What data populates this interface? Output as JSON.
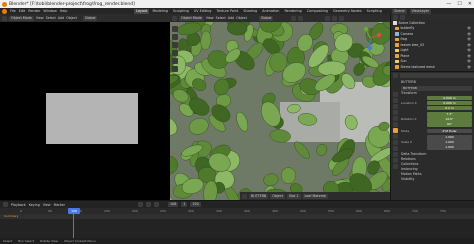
{
  "window": {
    "title": "Blender* [F:\\tobi\\blender-project\\frog\\frog_render.blend]",
    "controls": [
      "—",
      "☐",
      "✕"
    ]
  },
  "menu": {
    "items": [
      "File",
      "Edit",
      "Render",
      "Window",
      "Help"
    ],
    "workspaces": [
      "Layout",
      "Modeling",
      "Sculpting",
      "UV Editing",
      "Texture Paint",
      "Shading",
      "Animation",
      "Rendering",
      "Compositing",
      "Geometry Nodes",
      "Scripting"
    ],
    "active_workspace": "Layout",
    "scene_label": "Scene",
    "view_layer_label": "ViewLayer"
  },
  "left_editor": {
    "header_items": [
      "View",
      "Select",
      "Add",
      "Object"
    ],
    "mode": "Object Mode",
    "transform": "Global"
  },
  "viewport": {
    "mode": "Object Mode",
    "header_items": [
      "View",
      "Select",
      "Add",
      "Object"
    ],
    "transform": "Global",
    "leaf_color": "#5f8a3a",
    "bg_color": "#8a8f8a"
  },
  "outliner": {
    "title": "Scene Collection",
    "rows": [
      {
        "label": "butterfly",
        "color": "#e8a040"
      },
      {
        "label": "Camera",
        "color": "#8fb6d9"
      },
      {
        "label": "frog",
        "color": "#e8a040"
      },
      {
        "label": "leaves tree_03",
        "color": "#e8a040"
      },
      {
        "label": "Light",
        "color": "#e8d070"
      },
      {
        "label": "Plane",
        "color": "#e8a040"
      },
      {
        "label": "Sun",
        "color": "#e8d070"
      },
      {
        "label": "Stems textured mesh",
        "color": "#e8a040"
      }
    ]
  },
  "properties": {
    "object_name": "BUTTERB",
    "data_name": "BUTTERB",
    "section_transform": "Transform",
    "location_label": "Location X",
    "location": [
      "0.006 m",
      "0.006 m",
      "0.2 m"
    ],
    "rotation_label": "Rotation X",
    "rotation": [
      "7.3°",
      "16.6°",
      "90°"
    ],
    "mode_label": "Mode",
    "mode_value": "XYZ Euler",
    "scale_label": "Scale X",
    "scale": [
      "1.000",
      "1.000",
      "1.000"
    ],
    "collapsed_sections": [
      "Delta Transform",
      "Relations",
      "Collections",
      "Instancing",
      "Motion Paths",
      "Visibility"
    ]
  },
  "node_bar": {
    "object": "BUTTERB",
    "object2": "Object",
    "slot": "Slot 1",
    "material": "Leaf Material"
  },
  "timeline": {
    "header": [
      "Playback",
      "Keying",
      "View",
      "Marker"
    ],
    "current_frame": "108",
    "start": "1",
    "end": "250",
    "row_label": "Summary",
    "ruler": [
      "0",
      "50",
      "100",
      "150",
      "200",
      "250",
      "300",
      "350",
      "400",
      "450",
      "500",
      "550",
      "600",
      "650",
      "700",
      "750"
    ]
  },
  "statusbar": {
    "items": [
      "Select",
      "Box Select",
      "Rotate View",
      "Object Context Menu"
    ]
  }
}
